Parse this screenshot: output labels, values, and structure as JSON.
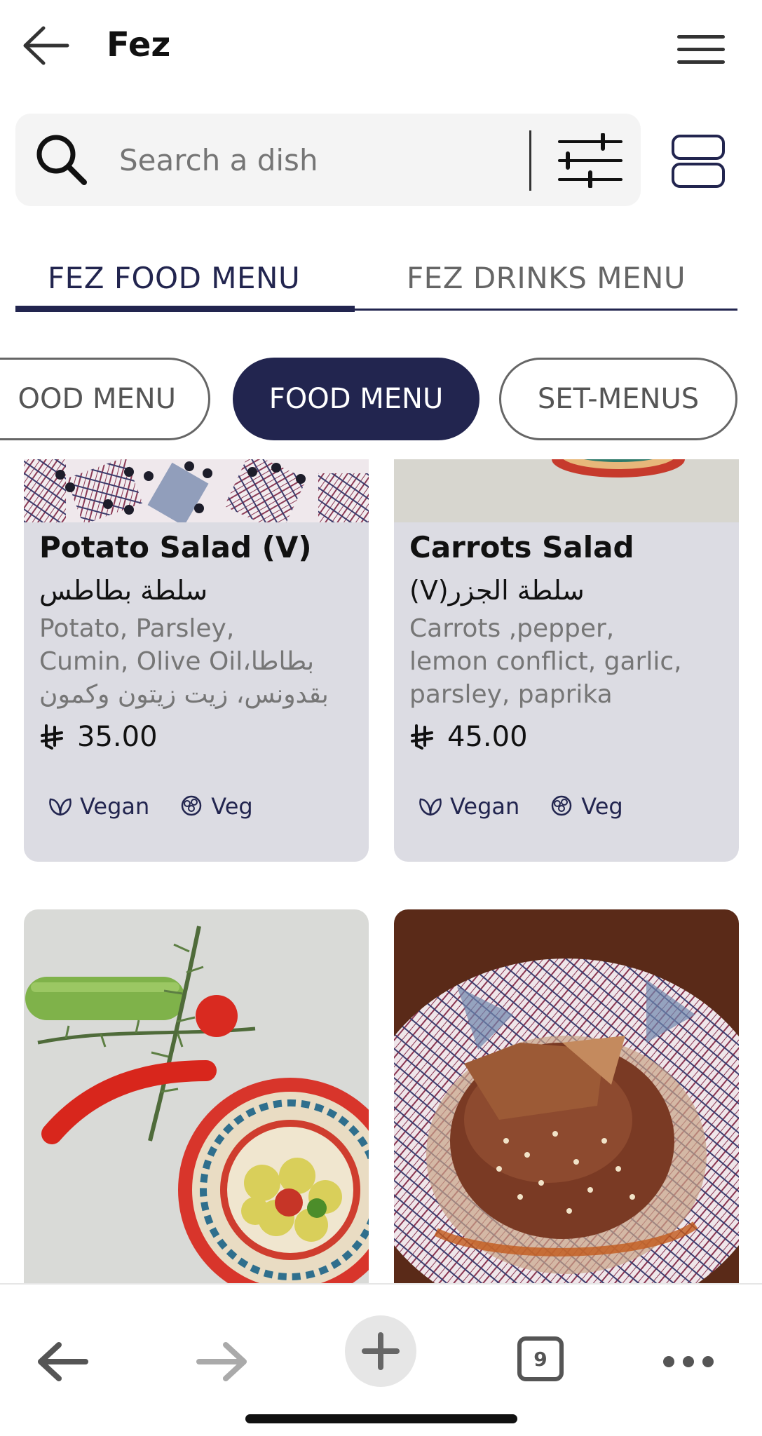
{
  "header": {
    "title": "Fez"
  },
  "search": {
    "placeholder": "Search a dish"
  },
  "menu_tabs": [
    {
      "label": "FEZ FOOD MENU",
      "active": true
    },
    {
      "label": "FEZ DRINKS MENU",
      "active": false
    }
  ],
  "categories": [
    {
      "label": "OOD MENU",
      "active": false
    },
    {
      "label": "FOOD MENU",
      "active": true
    },
    {
      "label": "SET-MENUS",
      "active": false
    }
  ],
  "dishes": [
    {
      "name": "Potato Salad (V)",
      "name_ar": "سلطة بطاطس",
      "desc_line1": "Potato, Parsley,",
      "desc_line2": "Cumin, Olive Oil،بطاطا",
      "desc_line3": "بقدونس، زيت زيتون وكمون",
      "price": "35.00",
      "tags": [
        "Vegan",
        "Veg"
      ]
    },
    {
      "name": "Carrots Salad",
      "name_ar": "(V)سلطة الجزر",
      "desc_line1": "Carrots ,pepper,",
      "desc_line2": "lemon conflict, garlic,",
      "desc_line3": "parsley, paprika",
      "price": "45.00",
      "tags": [
        "Vegan",
        "Veg"
      ]
    }
  ],
  "browser": {
    "tab_count": "9"
  },
  "colors": {
    "accent": "#22254f",
    "card_bg": "#dcdce3",
    "search_bg": "#f4f4f4"
  },
  "icons": [
    "back-arrow-icon",
    "hamburger-icon",
    "search-icon",
    "filter-sliders-icon",
    "layout-toggle-icon",
    "riyal-icon",
    "leaf-icon",
    "cauliflower-icon",
    "plus-icon",
    "more-icon"
  ]
}
